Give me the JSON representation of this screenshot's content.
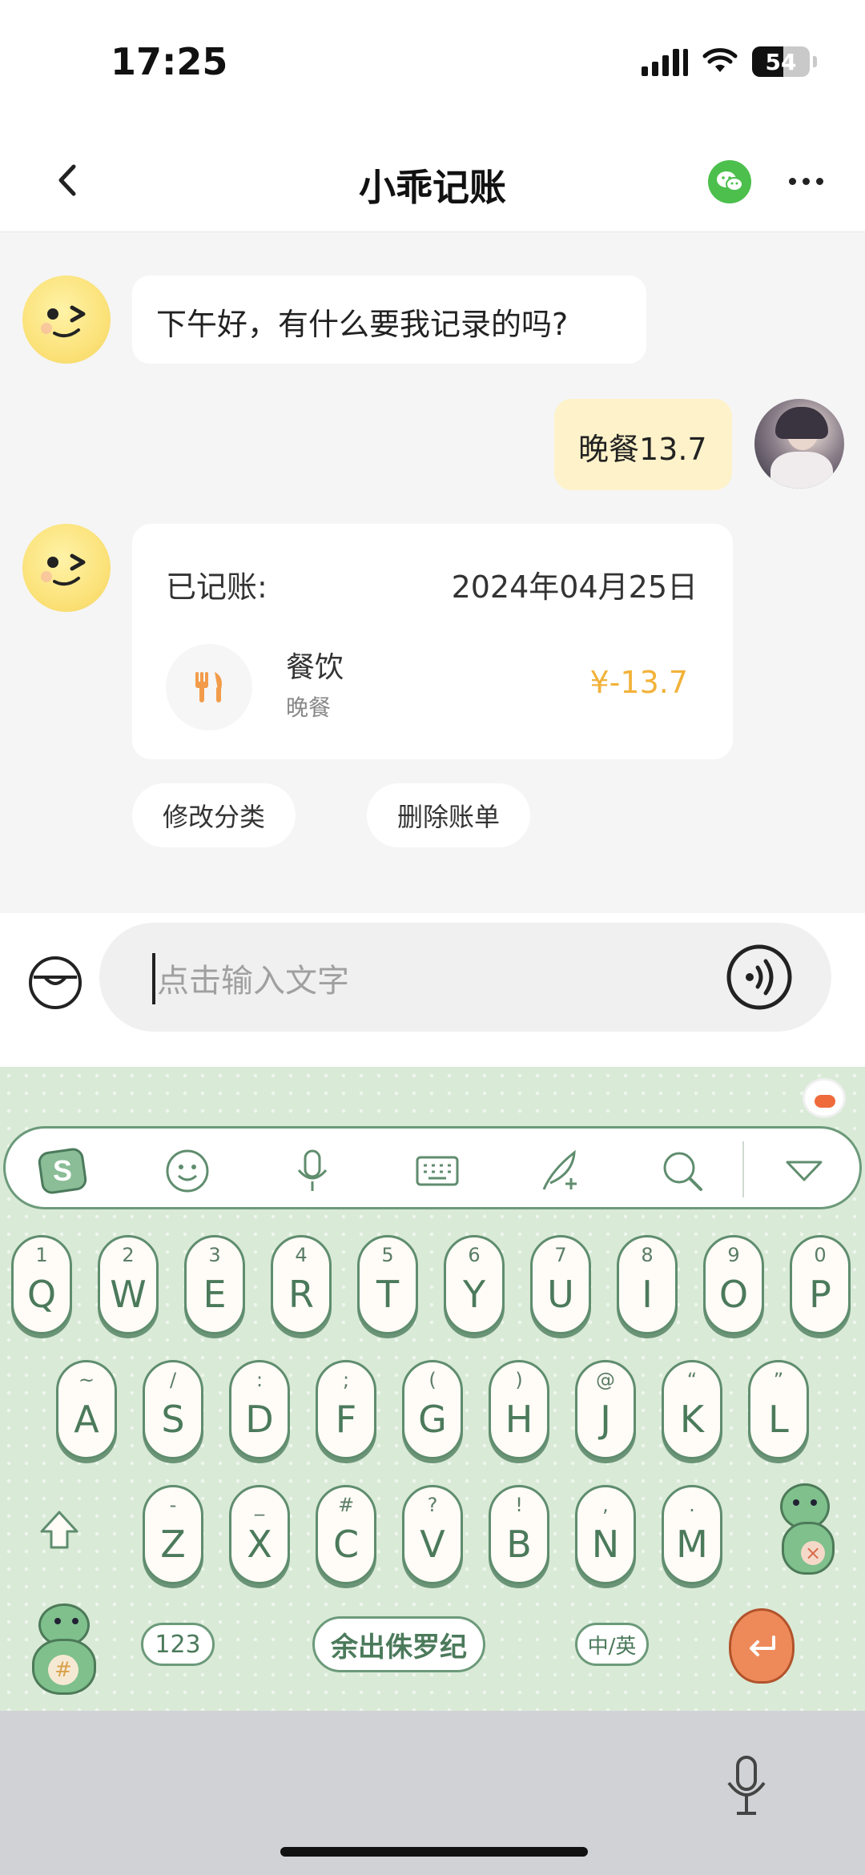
{
  "status_bar": {
    "time": "17:25",
    "battery": "54"
  },
  "header": {
    "title": "小乖记账"
  },
  "chat": {
    "bot_greeting": "下午好，有什么要我记录的吗?",
    "user_message": "晚餐13.7",
    "record_card": {
      "label": "已记账:",
      "date": "2024年04月25日",
      "category": "餐饮",
      "note": "晚餐",
      "amount": "¥-13.7"
    },
    "actions": [
      "修改分类",
      "删除账单"
    ]
  },
  "input": {
    "placeholder": "点击输入文字"
  },
  "keyboard": {
    "row1": [
      {
        "sub": "1",
        "main": "Q"
      },
      {
        "sub": "2",
        "main": "W"
      },
      {
        "sub": "3",
        "main": "E"
      },
      {
        "sub": "4",
        "main": "R"
      },
      {
        "sub": "5",
        "main": "T"
      },
      {
        "sub": "6",
        "main": "Y"
      },
      {
        "sub": "7",
        "main": "U"
      },
      {
        "sub": "8",
        "main": "I"
      },
      {
        "sub": "9",
        "main": "O"
      },
      {
        "sub": "0",
        "main": "P"
      }
    ],
    "row2": [
      {
        "sub": "~",
        "main": "A"
      },
      {
        "sub": "/",
        "main": "S"
      },
      {
        "sub": ":",
        "main": "D"
      },
      {
        "sub": ";",
        "main": "F"
      },
      {
        "sub": "(",
        "main": "G"
      },
      {
        "sub": ")",
        "main": "H"
      },
      {
        "sub": "@",
        "main": "J"
      },
      {
        "sub": "“",
        "main": "K"
      },
      {
        "sub": "”",
        "main": "L"
      }
    ],
    "row3": [
      {
        "sub": "-",
        "main": "Z"
      },
      {
        "sub": "_",
        "main": "X"
      },
      {
        "sub": "#",
        "main": "C"
      },
      {
        "sub": "?",
        "main": "V"
      },
      {
        "sub": "!",
        "main": "B"
      },
      {
        "sub": ",",
        "main": "N"
      },
      {
        "sub": ".",
        "main": "M"
      }
    ],
    "num_key": "123",
    "space_key": "余出侏罗纪",
    "lang_key": "中/英",
    "toolbar_icons": [
      "sogou-logo-icon",
      "emoji-icon",
      "mic-icon",
      "keyboard-icon",
      "handwrite-icon",
      "search-icon",
      "collapse-icon"
    ]
  },
  "colors": {
    "accent_amount": "#f2b23a",
    "user_bubble": "#fdf2c9",
    "keyboard_bg": "#d9ead7",
    "key_border": "#5f8d6e"
  }
}
